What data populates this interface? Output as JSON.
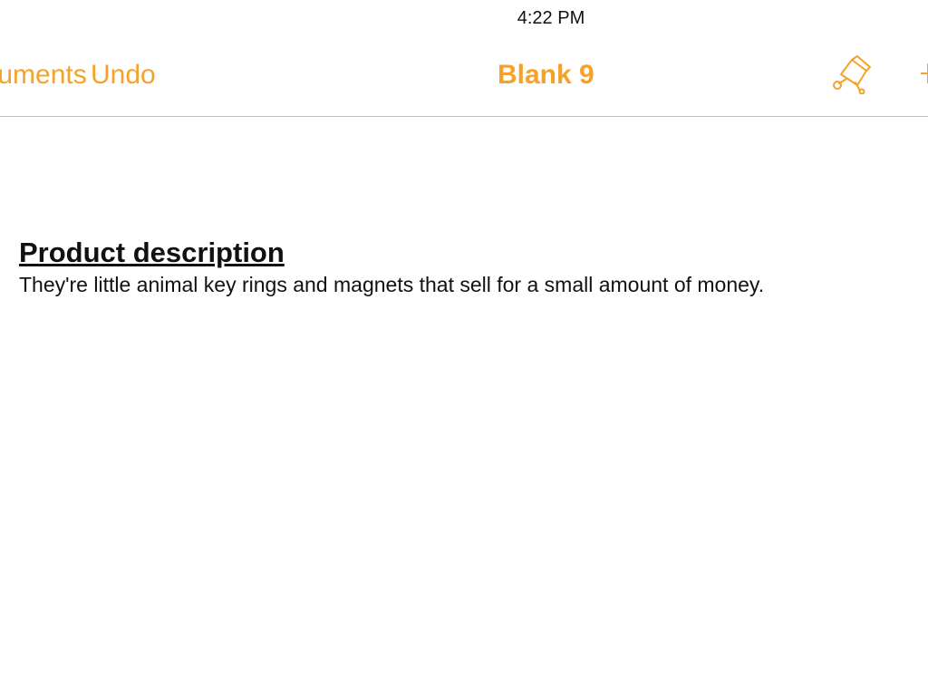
{
  "status_bar": {
    "time": "4:22 PM"
  },
  "toolbar": {
    "documents_label": "Documents",
    "undo_label": "Undo",
    "title": "Blank 9",
    "paintbrush_icon": "paintbrush-icon",
    "plus_icon": "plus-icon",
    "accent_color": "#f5a22a"
  },
  "document": {
    "heading": "Product description",
    "body": "They're little animal key rings and magnets that sell for a small amount of money."
  }
}
